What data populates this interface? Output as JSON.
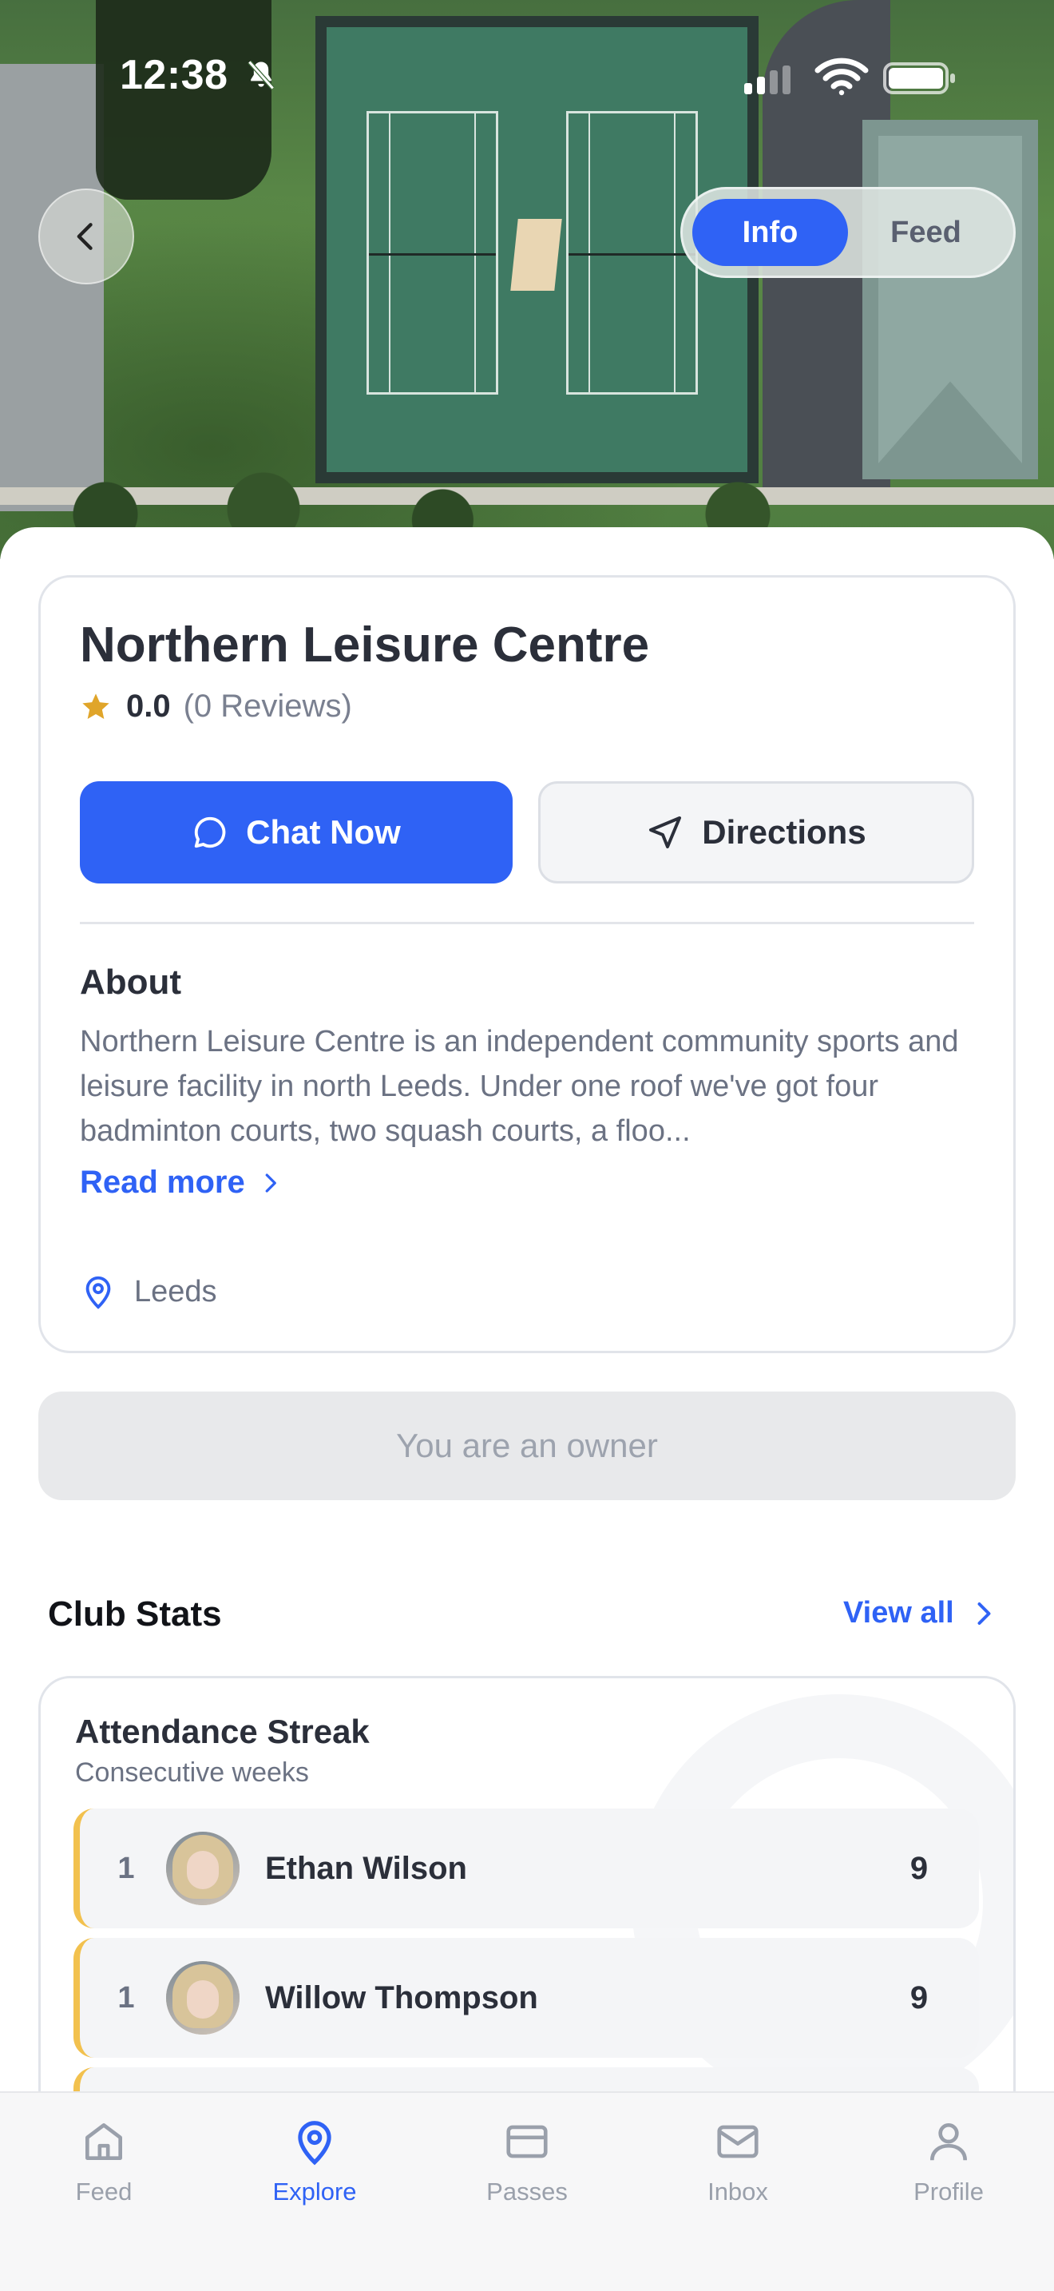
{
  "status_bar": {
    "time": "12:38"
  },
  "hero": {
    "segment": {
      "options": [
        "Info",
        "Feed"
      ],
      "selected": "Info"
    }
  },
  "venue": {
    "name": "Northern Leisure Centre",
    "rating": "0.0",
    "reviews": "(0 Reviews)",
    "chat_label": "Chat Now",
    "directions_label": "Directions",
    "about_title": "About",
    "about_text": "Northern Leisure Centre is an independent community sports and leisure facility in north Leeds. Under one roof we've got four badminton courts, two squash courts, a floo...",
    "read_more": "Read more",
    "location": "Leeds"
  },
  "owner_label": "You are an owner",
  "club_stats": {
    "title": "Club Stats",
    "view_all": "View all",
    "card_title": "Attendance Streak",
    "card_subtitle": "Consecutive weeks",
    "rows": [
      {
        "rank": "1",
        "name": "Ethan Wilson",
        "score": "9"
      },
      {
        "rank": "1",
        "name": "Willow Thompson",
        "score": "9"
      }
    ]
  },
  "tabbar": {
    "items": [
      {
        "label": "Feed",
        "icon": "home-icon"
      },
      {
        "label": "Explore",
        "icon": "location-pin-icon"
      },
      {
        "label": "Passes",
        "icon": "card-icon"
      },
      {
        "label": "Inbox",
        "icon": "mail-icon"
      },
      {
        "label": "Profile",
        "icon": "person-icon"
      }
    ],
    "active": "Explore"
  },
  "colors": {
    "accent": "#2f62f5",
    "star": "#e0a52a",
    "streak": "#f2c14e"
  }
}
